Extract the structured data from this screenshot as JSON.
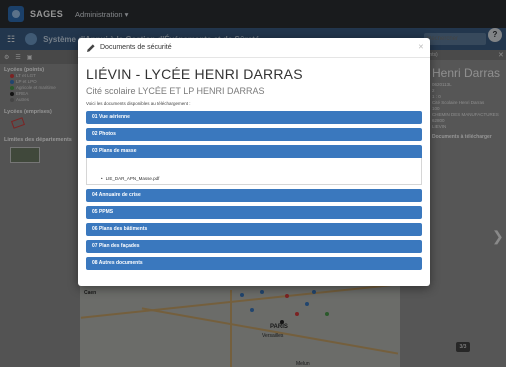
{
  "topnav": {
    "brand": "SAGES",
    "admin_menu": "Administration ▾"
  },
  "appbar": {
    "title": "Système d'Appui à la Gestion d'Événements et de Sûreté",
    "search_placeholder": "Rechercher",
    "help": "?"
  },
  "left_panel": {
    "tools": [
      "⚙",
      "☰",
      "▣"
    ],
    "layers": [
      {
        "title": "Lycées (points)",
        "legend": [
          {
            "label": "LT et LGT",
            "color": "#d43d3d"
          },
          {
            "label": "LP et LPO",
            "color": "#3a78be"
          },
          {
            "label": "Agricole et maritime",
            "color": "#4a9a4a"
          },
          {
            "label": "EREA",
            "color": "#222222"
          },
          {
            "label": "Autres",
            "color": "#777777"
          }
        ]
      },
      {
        "title": "Lycées (emprises)"
      },
      {
        "title": "Limites des départements"
      }
    ]
  },
  "map": {
    "labels": {
      "caen": "Caen",
      "paris": "PARIS",
      "versailles": "Versailles",
      "melun": "Melun"
    }
  },
  "right_panel": {
    "header": "Lycées (points)",
    "title": "Henri Darras",
    "info": [
      "0620113L",
      "2",
      "1 : 0",
      "Cité Scolaire Henri Darras",
      "100",
      "CHEMIN DES MANUFACTURES",
      "62800",
      "LIEVIN"
    ],
    "docs_link": "Documents à télécharger",
    "counter": "3/3"
  },
  "modal": {
    "title": "Documents de sécurité",
    "heading": "LIÉVIN - LYCÉE HENRI DARRAS",
    "subheading": "Cité scolaire LYCÉE ET LP HENRI DARRAS",
    "intro": "Voici les documents disponibles au téléchargement :",
    "sections": [
      {
        "label": "01 Vue aérienne"
      },
      {
        "label": "02 Photos"
      },
      {
        "label": "03 Plans de masse",
        "open": true,
        "files": [
          "LIE_DAR_APN_Masse.pdf"
        ]
      },
      {
        "label": "04 Annuaire de crise"
      },
      {
        "label": "05 PPMS"
      },
      {
        "label": "06 Plans des bâtiments"
      },
      {
        "label": "07 Plan des façades"
      },
      {
        "label": "08 Autres documents"
      }
    ]
  },
  "colors": {
    "accent": "#3a78be",
    "navbar": "#2b2f33",
    "appbar": "#3b5e86"
  },
  "icons": [
    "logo-icon",
    "grid-icon",
    "pencil-icon",
    "close-icon",
    "chevron-right-icon",
    "help-icon"
  ]
}
